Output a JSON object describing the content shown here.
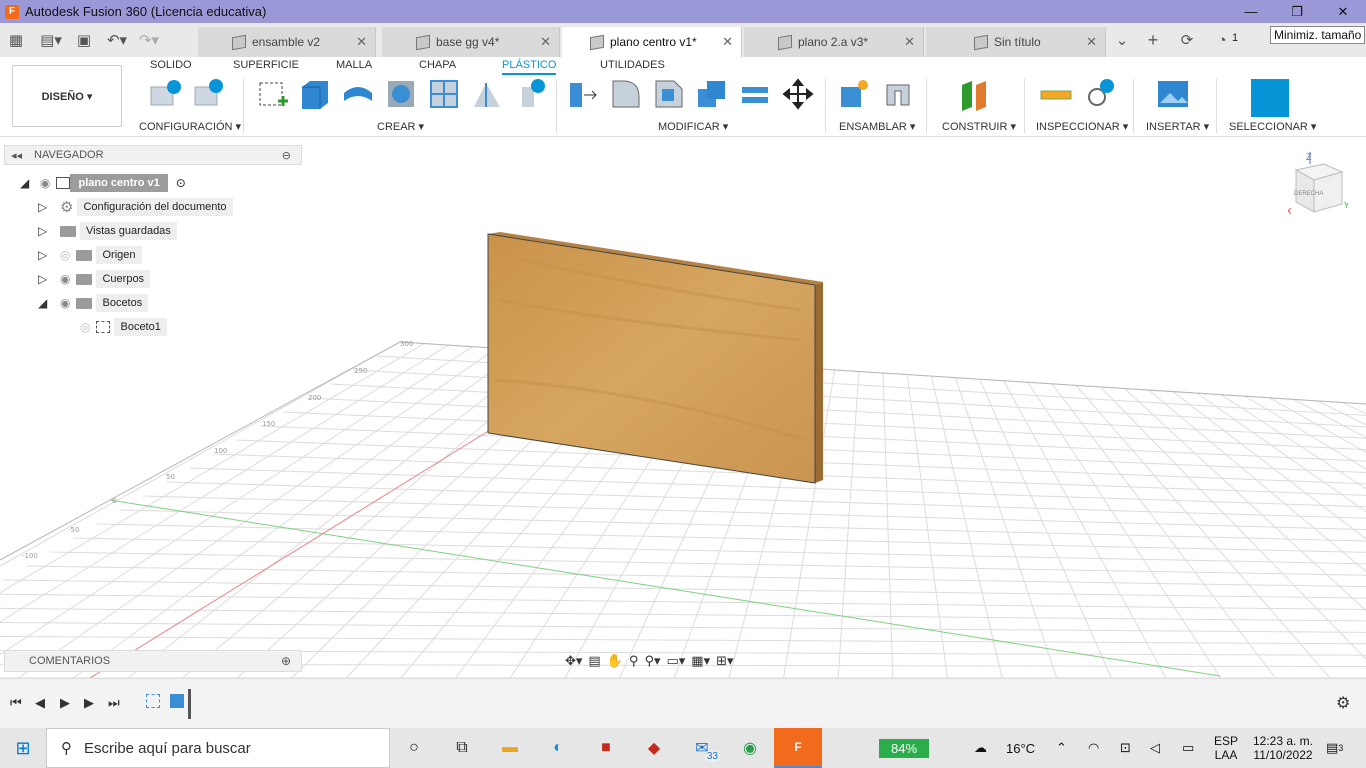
{
  "window": {
    "title": "Autodesk Fusion 360 (Licencia educativa)",
    "minimize": "—",
    "restore": "❐",
    "close": "✕",
    "tooltip": "Minimiz. tamaño"
  },
  "tabs": [
    {
      "label": "ensamble v2"
    },
    {
      "label": "base gg v4*"
    },
    {
      "label": "plano centro v1*",
      "active": true
    },
    {
      "label": "plano 2.a v3*"
    },
    {
      "label": "Sin título"
    }
  ],
  "tabbar": {
    "job_count": "1"
  },
  "ribbon": {
    "workspace": "DISEÑO ▾",
    "tabs": [
      "SOLIDO",
      "SUPERFICIE",
      "MALLA",
      "CHAPA",
      "PLÁSTICO",
      "UTILIDADES"
    ],
    "active_tab": "PLÁSTICO",
    "groups": [
      "CONFIGURACIÓN ▾",
      "CREAR ▾",
      "MODIFICAR ▾",
      "ENSAMBLAR ▾",
      "CONSTRUIR ▾",
      "INSPECCIONAR ▾",
      "INSERTAR ▾",
      "SELECCIONAR ▾"
    ]
  },
  "browser": {
    "header": "NAVEGADOR",
    "root": "plano centro v1",
    "items": [
      "Configuración del documento",
      "Vistas guardadas",
      "Origen",
      "Cuerpos",
      "Bocetos",
      "Boceto1"
    ]
  },
  "viewcube": {
    "face": "DERECHA",
    "axis_z": "Z",
    "axis_y": "Y",
    "axis_x": "X"
  },
  "grid_ticks": [
    "300",
    "250",
    "200",
    "150",
    "100",
    "50",
    "0",
    "-50",
    "-100"
  ],
  "comments": {
    "label": "COMENTARIOS"
  },
  "taskbar": {
    "search_placeholder": "Escribe aquí para buscar",
    "mail_badge": "33",
    "battery": "84%",
    "weather": "16°C",
    "lang1": "ESP",
    "lang2": "LAA",
    "time": "12:23 a. m.",
    "date": "11/10/2022",
    "notif": "3"
  },
  "colors": {
    "titlebar": "#9b98d8",
    "accent": "#0696d7",
    "wood": "#d6a660"
  }
}
